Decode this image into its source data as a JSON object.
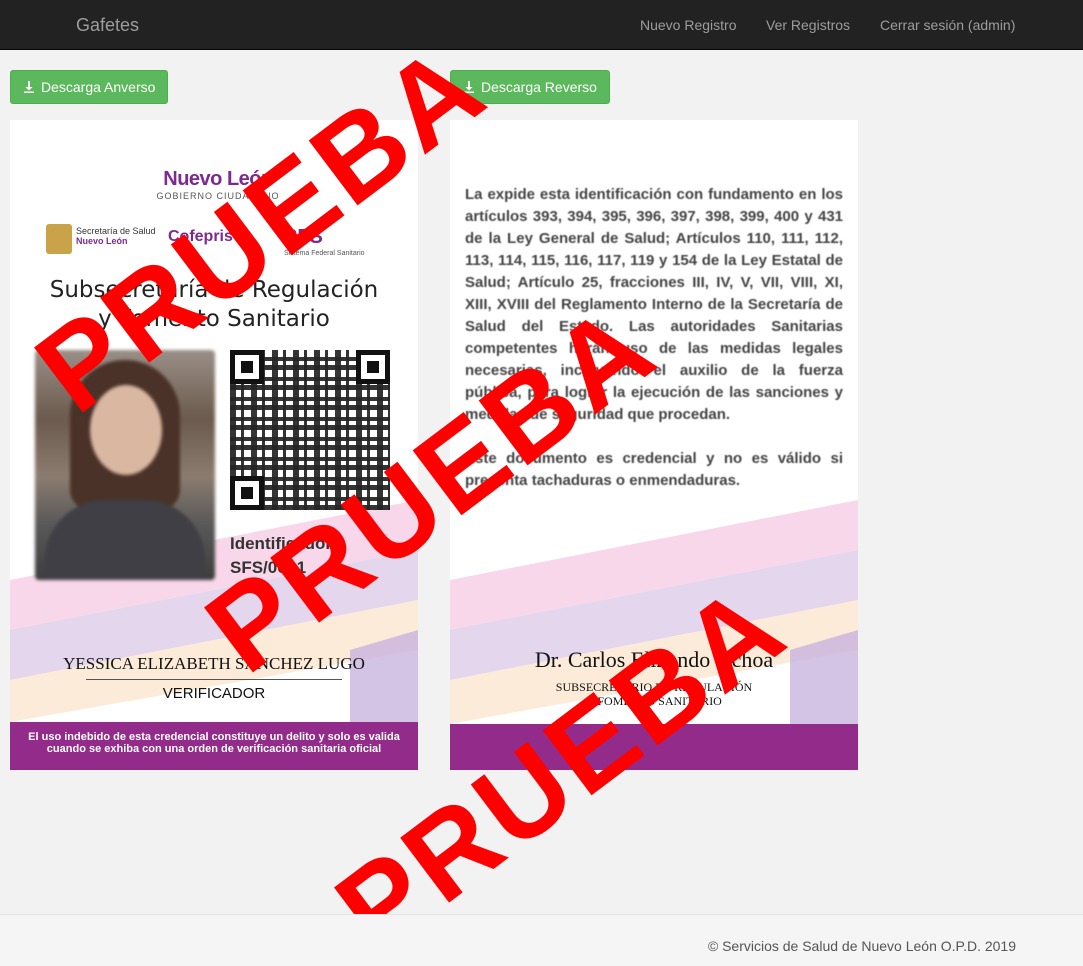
{
  "navbar": {
    "brand": "Gafetes",
    "links": [
      "Nuevo Registro",
      "Ver Registros",
      "Cerrar sesión (admin)"
    ]
  },
  "buttons": {
    "front_download": "Descarga Anverso",
    "back_download": "Descarga Reverso"
  },
  "front": {
    "logos": {
      "nuevo_leon": "Nuevo León",
      "nuevo_leon_sub": "GOBIERNO CIUDADANO",
      "secretaria": "Secretaría de Salud",
      "secretaria_sub": "Nuevo León",
      "cofepris": "Cofepris",
      "sfs": "SFS",
      "sfs_sub": "Sistema Federal Sanitario"
    },
    "heading_line1": "Subsecretaría de Regulación",
    "heading_line2": "y Fomento Sanitario",
    "identifier_label": "Identificador:",
    "identifier_value": "SFS/00+1",
    "person_name": "YESSICA ELIZABETH SÁNCHEZ LUGO",
    "person_role": "VERIFICADOR",
    "warning_line1": "El uso indebido de esta credencial constituye un delito y solo es valida",
    "warning_line2": "cuando se exhiba con una orden de verificación sanitaria oficial"
  },
  "back": {
    "legal_paragraph1": "La expide esta identificación con fundamento en los artículos 393, 394, 395, 396, 397, 398, 399, 400 y 431 de la Ley General de Salud; Artículos 110, 111, 112, 113, 114, 115, 116, 117, 119 y 154 de la Ley Estatal de Salud; Artículo 25, fracciones III, IV, V, VII, VIII, XI, XIII, XVIII del Reglamento Interno de la Secretaría de Salud del Estado. Las autoridades Sanitarias competentes harán uso de las medidas legales necesarias, incluyendo el auxilio de la fuerza pública, para lograr la ejecución de las sanciones y medidas de seguridad que procedan.",
    "legal_paragraph2": "Este documento es credencial y no es válido si presenta tachaduras o enmendaduras.",
    "signer_name": "Dr. Carlos Elizondo Ochoa",
    "signer_title_line1": "SUBSECRETARIO DE REGULACIÓN",
    "signer_title_line2": "Y FOMENTO SANITARIO"
  },
  "watermark": "PRUEBA",
  "footer": "© Servicios de Salud de Nuevo León O.P.D. 2019",
  "colors": {
    "navbar": "#222222",
    "button_green": "#5cb85c",
    "card_bar": "#922b89",
    "watermark": "#ff0000"
  }
}
